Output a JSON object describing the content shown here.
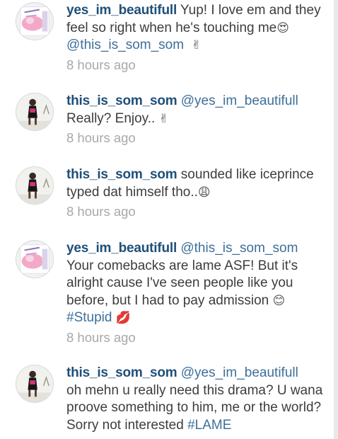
{
  "comments": [
    {
      "username": "yes_im_beautifull",
      "before": " Yup! I love em and they feel so right when he's touching me",
      "emoji1": "😍",
      "mention": "@this_is_som_som",
      "emoji2": "✌",
      "time": "8 hours ago",
      "avatar": "avatar-pink-sticker"
    },
    {
      "username": "this_is_som_som",
      "mention": "@yes_im_beautifull",
      "body": "Really? Enjoy..",
      "emoji": "✌",
      "time": "8 hours ago",
      "avatar": "avatar-woman-black-dress"
    },
    {
      "username": "this_is_som_som",
      "body": " sounded like iceprince typed dat himself tho..",
      "emoji": "😩",
      "time": "8 hours ago",
      "avatar": "avatar-woman-black-dress"
    },
    {
      "username": "yes_im_beautifull",
      "mention": "@this_is_som_som",
      "body": "Your comebacks are lame ASF! But it's alright cause I've seen people like you before, but I had to pay admission",
      "emoji1": "😊",
      "hashtag": "#Stupid",
      "emoji2": "💋",
      "time": "8 hours ago",
      "avatar": "avatar-pink-sticker"
    },
    {
      "username": "this_is_som_som",
      "mention": "@yes_im_beautifull",
      "body": "oh mehn u really need this drama? U wana proove something to him, me or the world? Sorry not interested",
      "hashtag": "#LAME",
      "avatar": "avatar-woman-black-dress"
    }
  ],
  "colors": {
    "username": "#1f4f7a",
    "mention": "#3d6f9a",
    "timestamp": "#a8a8a8",
    "body": "#3d3d3d"
  }
}
